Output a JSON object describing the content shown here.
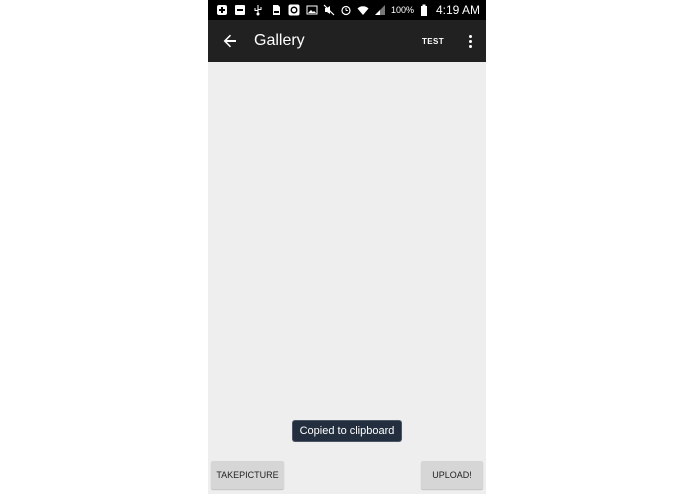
{
  "status_bar": {
    "battery_percent": "100%",
    "time": "4:19 AM",
    "icons_left": [
      "add-box-icon",
      "minus-box-icon",
      "usb-icon",
      "sd-card-icon",
      "s-app-icon",
      "image-icon"
    ],
    "icons_right": [
      "mute-icon",
      "alarm-icon",
      "wifi-icon",
      "signal-icon",
      "battery-icon"
    ]
  },
  "toolbar": {
    "title": "Gallery",
    "action_label": "TEST",
    "background": "#212121"
  },
  "toast": {
    "message": "Copied to clipboard"
  },
  "buttons": {
    "take_picture": "TAKEPICTURE",
    "upload": "UPLOAD!"
  }
}
